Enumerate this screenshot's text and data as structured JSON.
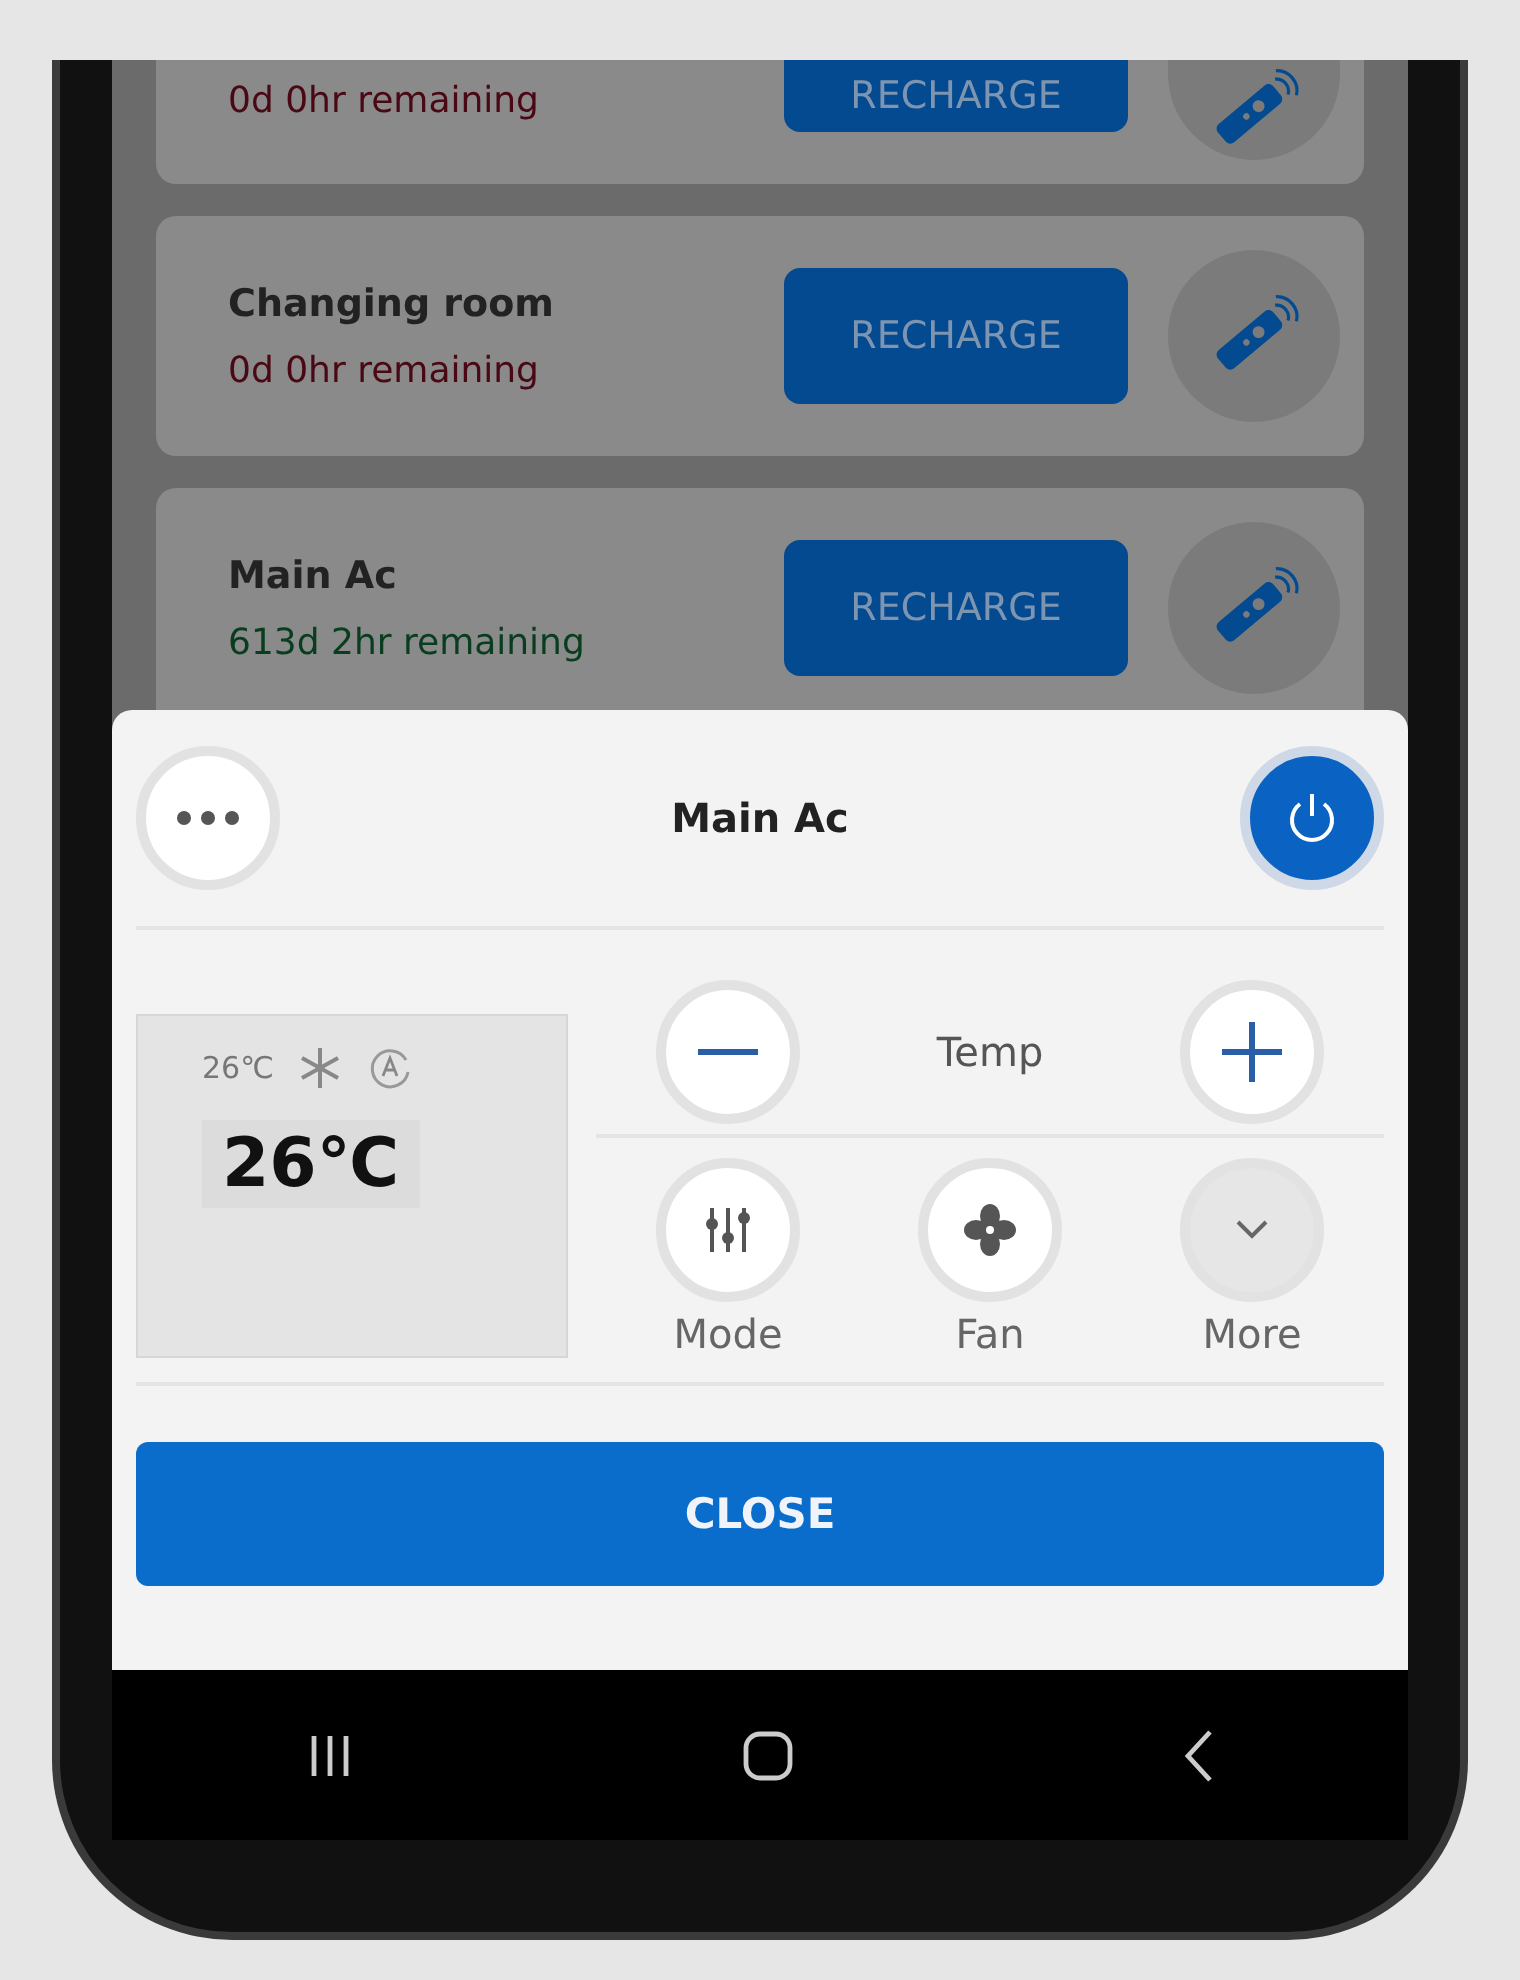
{
  "devices": [
    {
      "remaining": "0d 0hr remaining",
      "color": "#4a0814",
      "button": "RECHARGE"
    },
    {
      "name": "Changing room",
      "remaining": "0d 0hr remaining",
      "color": "#4a0814",
      "button": "RECHARGE"
    },
    {
      "name": "Main Ac",
      "remaining": "613d 2hr remaining",
      "color": "#083d1f",
      "button": "RECHARGE"
    }
  ],
  "sheet": {
    "title": "Main Ac",
    "power_on": true,
    "display": {
      "set_temp": "26℃",
      "current_temp": "26℃"
    },
    "temp_label": "Temp",
    "controls": [
      {
        "kind": "mode",
        "label": "Mode"
      },
      {
        "kind": "fan",
        "label": "Fan"
      },
      {
        "kind": "more",
        "label": "More"
      }
    ],
    "close_button": "CLOSE"
  }
}
